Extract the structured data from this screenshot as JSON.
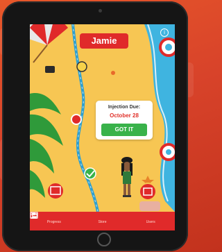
{
  "header": {
    "name": "Jamie"
  },
  "popup": {
    "title": "Injection Due:",
    "date": "October 28",
    "button_label": "GOT IT"
  },
  "tabs": [
    {
      "label": "Progress",
      "icon": "progress-icon"
    },
    {
      "label": "Store",
      "icon": "cart-icon"
    },
    {
      "label": "Users",
      "icon": "user-icon"
    }
  ],
  "icons": [
    "info-icon",
    "calendar-icon",
    "checkmark-icon",
    "umbrella-icon",
    "life-ring-icon",
    "avatar"
  ],
  "colors": {
    "accent_red": "#e02a2a",
    "sand": "#f7c653",
    "sea": "#3fb4e0",
    "path": "#2e9fcf",
    "button_green": "#39b24a",
    "date_red": "#e0312a"
  }
}
